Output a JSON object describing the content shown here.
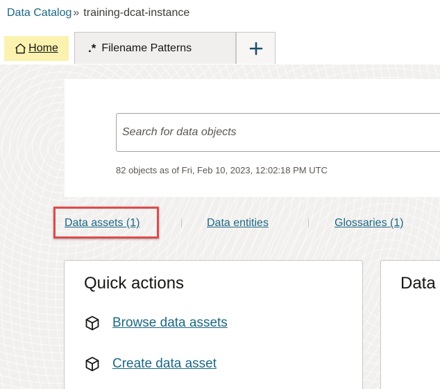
{
  "breadcrumb": {
    "root": "Data Catalog",
    "separator": "»",
    "current": "training-dcat-instance"
  },
  "tabs": {
    "home": {
      "label": "Home",
      "icon": "home-icon"
    },
    "patterns": {
      "label": "Filename Patterns",
      "glyph": ".*"
    },
    "add": {
      "label": "+"
    }
  },
  "search": {
    "placeholder": "Search for data objects",
    "status": "82 objects as of Fri, Feb 10, 2023, 12:02:18 PM UTC"
  },
  "summary": {
    "data_assets": "Data assets (1)",
    "data_entities": "Data entities",
    "glossaries": "Glossaries (1)"
  },
  "quick_actions": {
    "title": "Quick actions",
    "browse": "Browse data assets",
    "create": "Create data asset"
  },
  "data_card": {
    "title": "Data"
  },
  "colors": {
    "link": "#1b6785",
    "home_tab_bg": "#fbf2b0",
    "highlight": "#e04a4a"
  }
}
